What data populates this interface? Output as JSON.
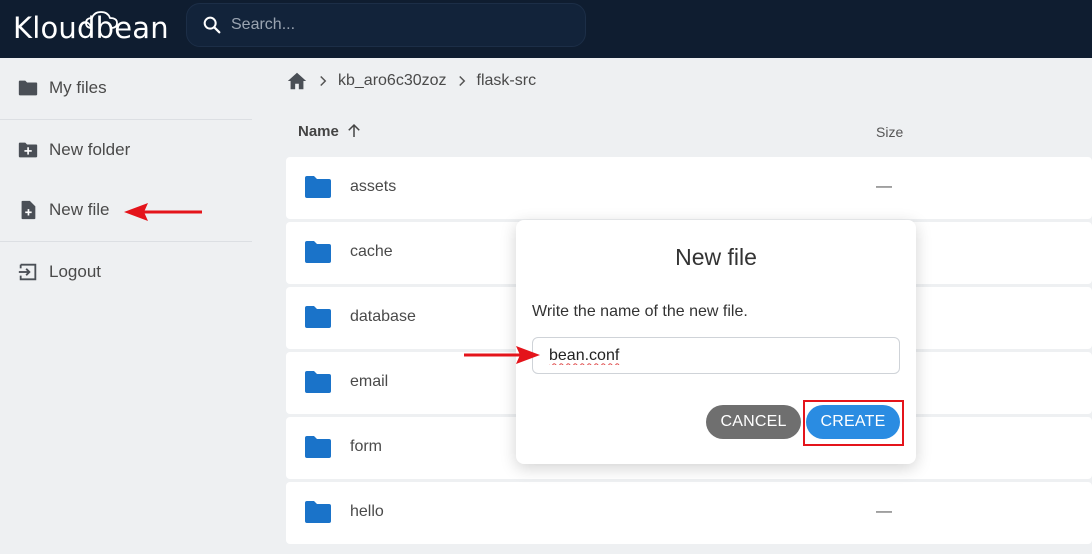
{
  "app": {
    "logo_text": "Kloudbean"
  },
  "search": {
    "placeholder": "Search..."
  },
  "sidebar": {
    "items": [
      {
        "label": "My files",
        "icon": "folder-icon"
      },
      {
        "label": "New folder",
        "icon": "folder-plus-icon"
      },
      {
        "label": "New file",
        "icon": "file-plus-icon"
      },
      {
        "label": "Logout",
        "icon": "logout-icon"
      }
    ]
  },
  "breadcrumb": {
    "items": [
      "kb_aro6c30zoz",
      "flask-src"
    ]
  },
  "table": {
    "columns": {
      "name": "Name",
      "size": "Size"
    },
    "rows": [
      {
        "name": "assets",
        "size": "—"
      },
      {
        "name": "cache",
        "size": ""
      },
      {
        "name": "database",
        "size": ""
      },
      {
        "name": "email",
        "size": ""
      },
      {
        "name": "form",
        "size": ""
      },
      {
        "name": "hello",
        "size": "—"
      }
    ]
  },
  "dialog": {
    "title": "New file",
    "message": "Write the name of the new file.",
    "input_value": "bean.conf",
    "cancel_label": "CANCEL",
    "create_label": "CREATE"
  },
  "colors": {
    "header_bg": "#0f1d30",
    "folder_blue": "#1a73c9",
    "primary_button": "#2a8ce2",
    "secondary_button": "#6f6f6f",
    "annotation_red": "#e4141b"
  }
}
